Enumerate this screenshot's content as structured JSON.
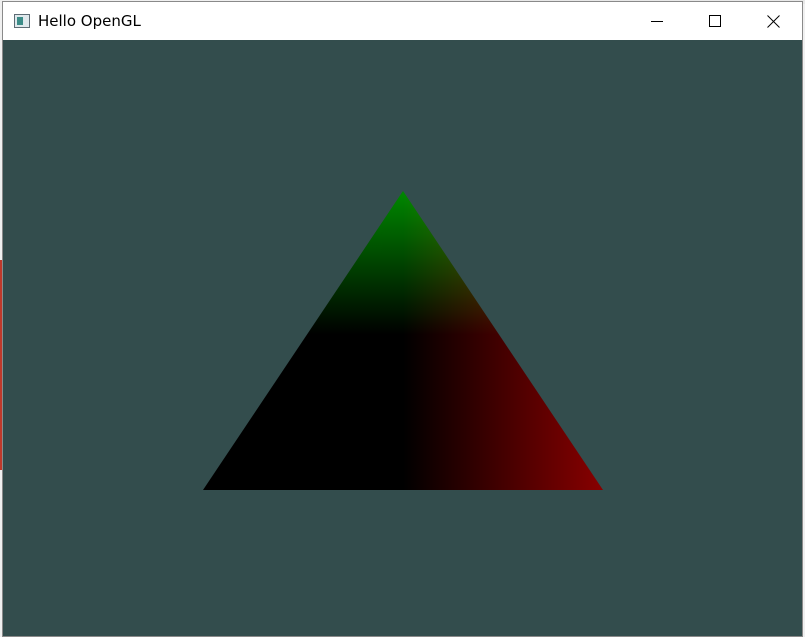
{
  "window": {
    "title": "Hello OpenGL",
    "clear_color": "#334d4d"
  },
  "title_bar": {
    "app_icon": "window-app-icon",
    "buttons": [
      "minimize-icon",
      "maximize-icon",
      "close-icon"
    ]
  },
  "triangle": {
    "vertex_colors": {
      "top": "#00ff00",
      "bottom_right": "#ff0000",
      "bottom_left": "#000000"
    }
  }
}
